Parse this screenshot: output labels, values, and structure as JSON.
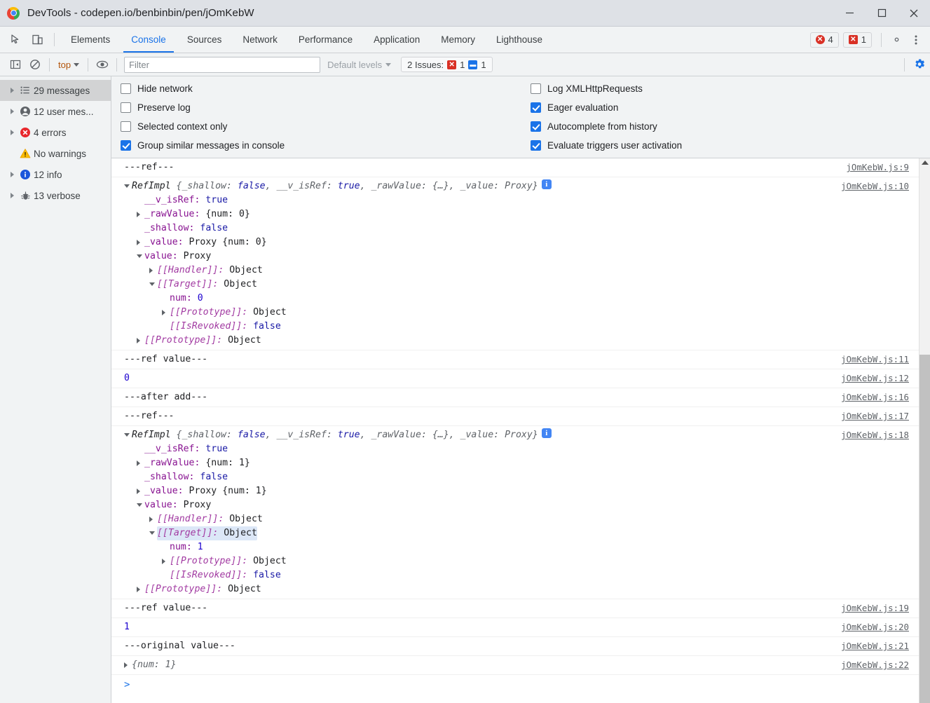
{
  "window": {
    "title": "DevTools - codepen.io/benbinbin/pen/jOmKebW",
    "minimize": "minimize",
    "maximize": "maximize",
    "close": "close"
  },
  "tabstrip": {
    "tabs": [
      {
        "label": "Elements",
        "active": false
      },
      {
        "label": "Console",
        "active": true
      },
      {
        "label": "Sources",
        "active": false
      },
      {
        "label": "Network",
        "active": false
      },
      {
        "label": "Performance",
        "active": false
      },
      {
        "label": "Application",
        "active": false
      },
      {
        "label": "Memory",
        "active": false
      },
      {
        "label": "Lighthouse",
        "active": false
      }
    ],
    "error_count": "4",
    "issue_count": "1",
    "settings_label": "Settings",
    "more_label": "More options"
  },
  "toolbar": {
    "context": "top",
    "filter_placeholder": "Filter",
    "filter_value": "",
    "levels_label": "Default levels",
    "issues_label": "2 Issues:",
    "issues_errors": "1",
    "issues_messages": "1"
  },
  "sidebar": {
    "items": [
      {
        "label": "29 messages",
        "icon": "list-icon",
        "selected": true,
        "arrow": true
      },
      {
        "label": "12 user mes...",
        "icon": "user-icon",
        "selected": false,
        "arrow": true
      },
      {
        "label": "4 errors",
        "icon": "error-icon",
        "selected": false,
        "arrow": true
      },
      {
        "label": "No warnings",
        "icon": "warning-icon",
        "selected": false,
        "arrow": false
      },
      {
        "label": "12 info",
        "icon": "info-icon",
        "selected": false,
        "arrow": true
      },
      {
        "label": "13 verbose",
        "icon": "bug-icon",
        "selected": false,
        "arrow": true
      }
    ]
  },
  "settings": {
    "left": [
      {
        "label": "Hide network",
        "checked": false
      },
      {
        "label": "Preserve log",
        "checked": false
      },
      {
        "label": "Selected context only",
        "checked": false
      },
      {
        "label": "Group similar messages in console",
        "checked": true
      }
    ],
    "right": [
      {
        "label": "Log XMLHttpRequests",
        "checked": false
      },
      {
        "label": "Eager evaluation",
        "checked": true
      },
      {
        "label": "Autocomplete from history",
        "checked": true
      },
      {
        "label": "Evaluate triggers user activation",
        "checked": true
      }
    ]
  },
  "log": {
    "msg_ref_1": "---ref---",
    "msg_ref_value_1": "---ref value---",
    "msg_zero": "0",
    "msg_after_add": "---after add---",
    "msg_ref_2": "---ref---",
    "msg_ref_value_2": "---ref value---",
    "msg_one": "1",
    "msg_original_value": "---original value---",
    "obj_preview_num1": "{num: 1}",
    "refimpl_head": {
      "class": "RefImpl ",
      "open": "{",
      "p1": "_shallow: ",
      "v1": "false",
      "s1": ", ",
      "p2": "__v_isRef: ",
      "v2": "true",
      "s2": ", ",
      "p3": "_rawValue: ",
      "v3": "{…}",
      "s3": ", ",
      "p4": "_value: ",
      "v4": "Proxy",
      "close": "}"
    },
    "props_0": {
      "isref_k": "__v_isRef: ",
      "isref_v": "true",
      "rawvalue_k": "_rawValue: ",
      "rawvalue_v": "{num: 0}",
      "shallow_k": "_shallow: ",
      "shallow_v": "false",
      "value_k": "_value: ",
      "value_v": "Proxy {num: 0}",
      "proxy_k": "value: ",
      "proxy_v": "Proxy",
      "handler": "[[Handler]]: ",
      "handler_v": "Object",
      "target": "[[Target]]: ",
      "target_v": "Object",
      "num_k": "num: ",
      "num_v": "0",
      "proto": "[[Prototype]]: ",
      "proto_v": "Object",
      "isrevoked": "[[IsRevoked]]: ",
      "isrevoked_v": "false",
      "outer_proto": "[[Prototype]]: ",
      "outer_proto_v": "Object"
    },
    "props_1": {
      "isref_k": "__v_isRef: ",
      "isref_v": "true",
      "rawvalue_k": "_rawValue: ",
      "rawvalue_v": "{num: 1}",
      "shallow_k": "_shallow: ",
      "shallow_v": "false",
      "value_k": "_value: ",
      "value_v": "Proxy {num: 1}",
      "proxy_k": "value: ",
      "proxy_v": "Proxy",
      "handler": "[[Handler]]: ",
      "handler_v": "Object",
      "target": "[[Target]]: ",
      "target_v": "Object",
      "num_k": "num: ",
      "num_v": "1",
      "proto": "[[Prototype]]: ",
      "proto_v": "Object",
      "isrevoked": "[[IsRevoked]]: ",
      "isrevoked_v": "false",
      "outer_proto": "[[Prototype]]: ",
      "outer_proto_v": "Object"
    },
    "sources": {
      "s9": "jOmKebW.js:9",
      "s10": "jOmKebW.js:10",
      "s11": "jOmKebW.js:11",
      "s12": "jOmKebW.js:12",
      "s16": "jOmKebW.js:16",
      "s17": "jOmKebW.js:17",
      "s18": "jOmKebW.js:18",
      "s19": "jOmKebW.js:19",
      "s20": "jOmKebW.js:20",
      "s21": "jOmKebW.js:21",
      "s22": "jOmKebW.js:22"
    },
    "prompt": ">"
  },
  "colors": {
    "accent": "#1a73e8",
    "error": "#d93025",
    "warning": "#f9ab00",
    "property": "#881391",
    "internal_slot": "#a23ba2",
    "value": "#1a1aa6",
    "number": "#1c00cf",
    "context": "#b3550b"
  }
}
